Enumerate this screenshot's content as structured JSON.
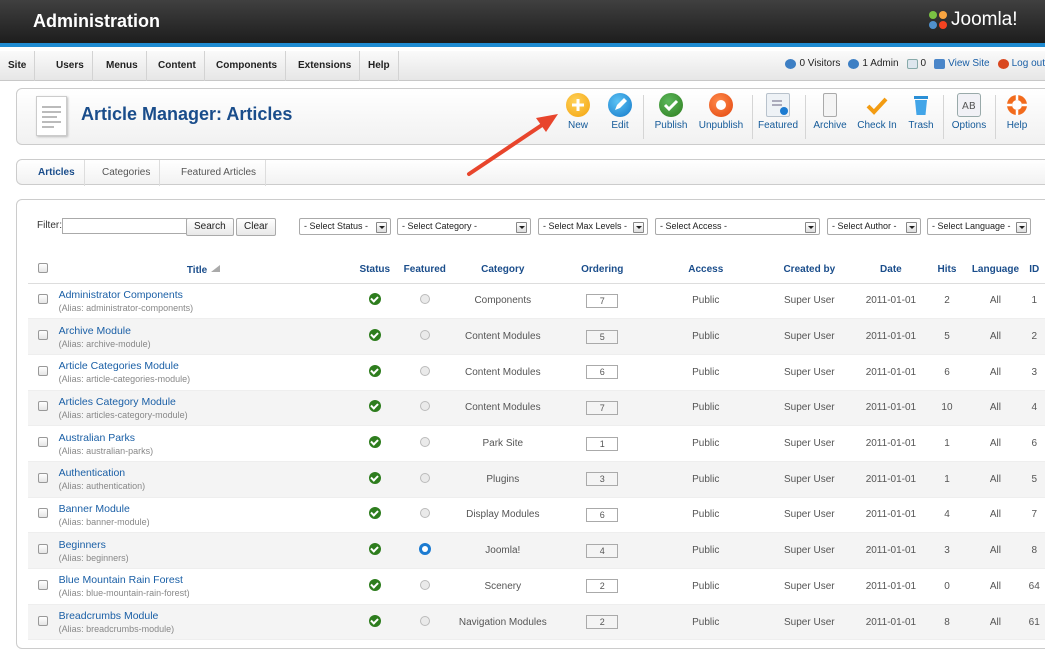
{
  "header": {
    "app_title": "Administration",
    "logo_text": "Joomla!"
  },
  "menu": [
    "Site",
    "Users",
    "Menus",
    "Content",
    "Components",
    "Extensions",
    "Help"
  ],
  "status": {
    "visitors": "0 Visitors",
    "admins": "1 Admin",
    "messages": "0",
    "view_site": "View Site",
    "logout": "Log out"
  },
  "toolbar": {
    "page_title": "Article Manager: Articles",
    "buttons": [
      {
        "label": "New",
        "icon": "new-icon"
      },
      {
        "label": "Edit",
        "icon": "edit-icon"
      },
      {
        "label": "Publish",
        "icon": "publish-icon"
      },
      {
        "label": "Unpublish",
        "icon": "unpublish-icon"
      },
      {
        "label": "Featured",
        "icon": "featured-icon"
      },
      {
        "label": "Archive",
        "icon": "archive-icon"
      },
      {
        "label": "Check In",
        "icon": "checkin-icon"
      },
      {
        "label": "Trash",
        "icon": "trash-icon"
      },
      {
        "label": "Options",
        "icon": "options-icon"
      },
      {
        "label": "Help",
        "icon": "help-icon"
      }
    ]
  },
  "subnav": [
    "Articles",
    "Categories",
    "Featured Articles"
  ],
  "filter": {
    "label": "Filter:",
    "search_value": "",
    "search_button": "Search",
    "clear_button": "Clear",
    "selects": [
      "- Select Status -",
      "- Select Category -",
      "- Select Max Levels -",
      "- Select Access -",
      "- Select Author -",
      "- Select Language -"
    ]
  },
  "table": {
    "headers": [
      "Title",
      "Status",
      "Featured",
      "Category",
      "Ordering",
      "Access",
      "Created by",
      "Date",
      "Hits",
      "Language",
      "ID"
    ],
    "alias_prefix": "(Alias: ",
    "rows": [
      {
        "title": "Administrator Components",
        "alias": "administrator-components",
        "featured": false,
        "category": "Components",
        "ordering": "7",
        "access": "Public",
        "created_by": "Super User",
        "date": "2011-01-01",
        "hits": "2",
        "language": "All",
        "id": "1"
      },
      {
        "title": "Archive Module",
        "alias": "archive-module",
        "featured": false,
        "category": "Content Modules",
        "ordering": "5",
        "access": "Public",
        "created_by": "Super User",
        "date": "2011-01-01",
        "hits": "5",
        "language": "All",
        "id": "2"
      },
      {
        "title": "Article Categories Module",
        "alias": "article-categories-module",
        "featured": false,
        "category": "Content Modules",
        "ordering": "6",
        "access": "Public",
        "created_by": "Super User",
        "date": "2011-01-01",
        "hits": "6",
        "language": "All",
        "id": "3"
      },
      {
        "title": "Articles Category Module",
        "alias": "articles-category-module",
        "featured": false,
        "category": "Content Modules",
        "ordering": "7",
        "access": "Public",
        "created_by": "Super User",
        "date": "2011-01-01",
        "hits": "10",
        "language": "All",
        "id": "4"
      },
      {
        "title": "Australian Parks",
        "alias": "australian-parks",
        "featured": false,
        "category": "Park Site",
        "ordering": "1",
        "access": "Public",
        "created_by": "Super User",
        "date": "2011-01-01",
        "hits": "1",
        "language": "All",
        "id": "6"
      },
      {
        "title": "Authentication",
        "alias": "authentication",
        "featured": false,
        "category": "Plugins",
        "ordering": "3",
        "access": "Public",
        "created_by": "Super User",
        "date": "2011-01-01",
        "hits": "1",
        "language": "All",
        "id": "5"
      },
      {
        "title": "Banner Module",
        "alias": "banner-module",
        "featured": false,
        "category": "Display Modules",
        "ordering": "6",
        "access": "Public",
        "created_by": "Super User",
        "date": "2011-01-01",
        "hits": "4",
        "language": "All",
        "id": "7"
      },
      {
        "title": "Beginners",
        "alias": "beginners",
        "featured": true,
        "category": "Joomla!",
        "ordering": "4",
        "access": "Public",
        "created_by": "Super User",
        "date": "2011-01-01",
        "hits": "3",
        "language": "All",
        "id": "8"
      },
      {
        "title": "Blue Mountain Rain Forest",
        "alias": "blue-mountain-rain-forest",
        "featured": false,
        "category": "Scenery",
        "ordering": "2",
        "access": "Public",
        "created_by": "Super User",
        "date": "2011-01-01",
        "hits": "0",
        "language": "All",
        "id": "64"
      },
      {
        "title": "Breadcrumbs Module",
        "alias": "breadcrumbs-module",
        "featured": false,
        "category": "Navigation Modules",
        "ordering": "2",
        "access": "Public",
        "created_by": "Super User",
        "date": "2011-01-01",
        "hits": "8",
        "language": "All",
        "id": "61"
      }
    ]
  },
  "colors": {
    "accent_blue": "#1f8bd1",
    "title_blue": "#1a4d8b",
    "link_blue": "#1a5fa6",
    "publish_green": "#2e7d1e",
    "arrow_red": "#e8452c"
  }
}
